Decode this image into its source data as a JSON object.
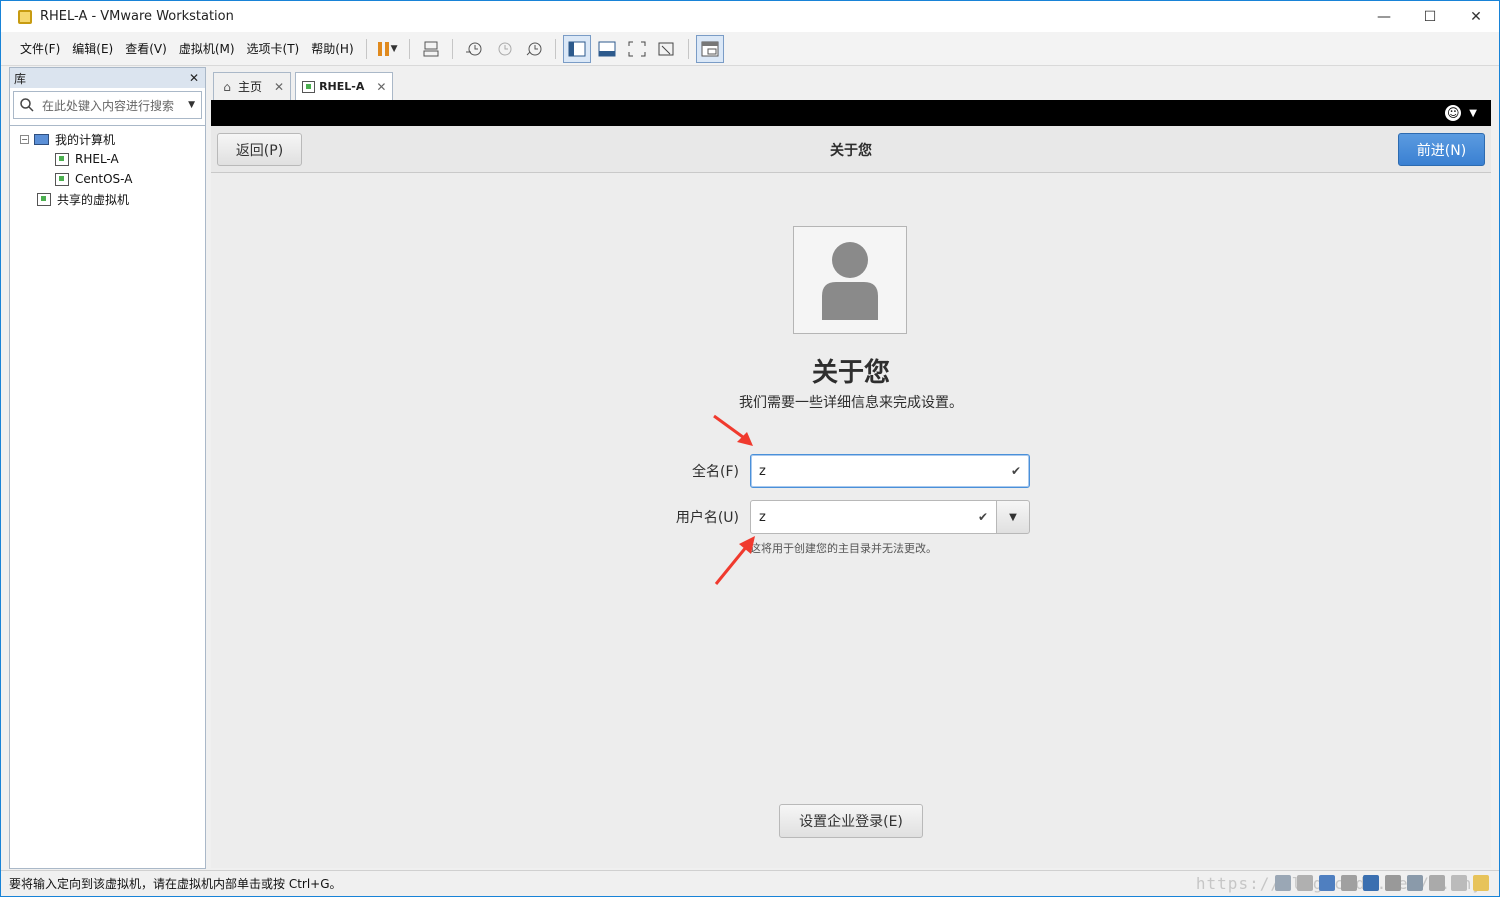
{
  "window": {
    "title": "RHEL-A - VMware Workstation",
    "minimize": "—",
    "maximize": "☐",
    "close": "✕"
  },
  "menu": [
    "文件(F)",
    "编辑(E)",
    "查看(V)",
    "虚拟机(M)",
    "选项卡(T)",
    "帮助(H)"
  ],
  "library": {
    "title": "库",
    "close": "✕",
    "search_placeholder": "在此处键入内容进行搜索",
    "tree": {
      "root": "我的计算机",
      "vms": [
        "RHEL-A",
        "CentOS-A"
      ],
      "shared": "共享的虚拟机"
    }
  },
  "tabs": [
    {
      "label": "主页",
      "close": "✕"
    },
    {
      "label": "RHEL-A",
      "close": "✕"
    }
  ],
  "guest": {
    "back_button": "返回(P)",
    "header_title": "关于您",
    "next_button": "前进(N)",
    "heading": "关于您",
    "subheading": "我们需要一些详细信息来完成设置。",
    "fullname_label": "全名(F)",
    "fullname_value": "z",
    "username_label": "用户名(U)",
    "username_value": "z",
    "username_hint": "这将用于创建您的主目录并无法更改。",
    "enterprise_button": "设置企业登录(E)"
  },
  "status": {
    "text": "要将输入定向到该虚拟机，请在虚拟机内部单击或按 Ctrl+G。",
    "watermark": "https://blog.csdn.net/...hy"
  },
  "colors": {
    "accent": "#3a80d2",
    "annotation_arrow": "#f03a2e"
  }
}
